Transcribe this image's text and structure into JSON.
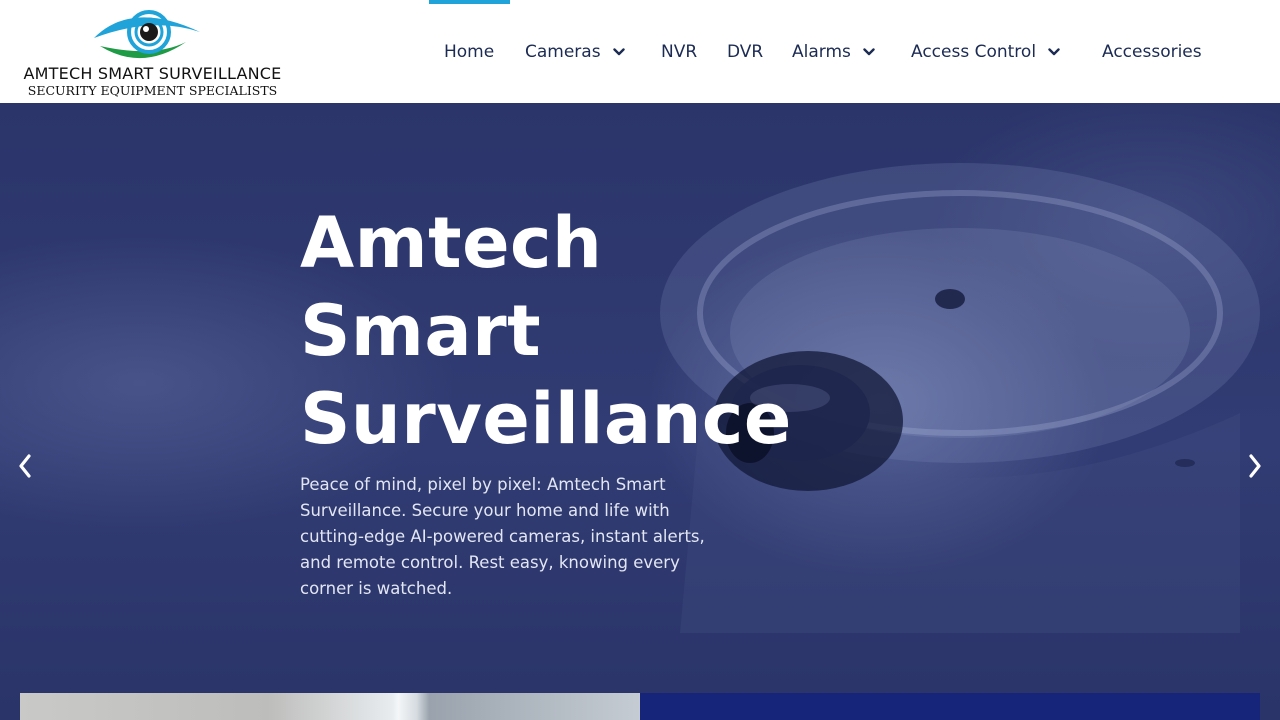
{
  "brand": {
    "name": "AMTECH SMART SURVEILLANCE",
    "tagline": "SECURITY EQUIPMENT SPECIALISTS",
    "logo_icon": "eye-icon",
    "colors": {
      "blue": "#1fa3d8",
      "green": "#1f9a45"
    }
  },
  "nav": {
    "items": [
      {
        "label": "Home",
        "active": true,
        "dropdown": false
      },
      {
        "label": "Cameras",
        "active": false,
        "dropdown": true
      },
      {
        "label": "NVR",
        "active": false,
        "dropdown": false
      },
      {
        "label": "DVR",
        "active": false,
        "dropdown": false
      },
      {
        "label": "Alarms",
        "active": false,
        "dropdown": true
      },
      {
        "label": "Access Control",
        "active": false,
        "dropdown": true
      },
      {
        "label": "Accessories",
        "active": false,
        "dropdown": false
      }
    ],
    "active_color": "#1fa3d8",
    "text_color": "#1c2b54"
  },
  "hero": {
    "title_lines": [
      "Amtech",
      "Smart",
      "Surveillance"
    ],
    "description": "Peace of mind, pixel by pixel: Amtech Smart Surveillance. Secure your home and life with cutting-edge AI-powered cameras, instant alerts, and remote control. Rest easy, knowing every corner is watched.",
    "prev_icon": "chevron-left-icon",
    "next_icon": "chevron-right-icon",
    "overlay_color": "#2b3670"
  },
  "bottom": {
    "right_panel_color": "#16257a"
  }
}
